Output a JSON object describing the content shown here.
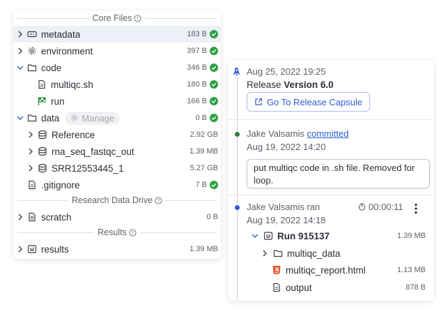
{
  "files_panel": {
    "sections": {
      "core_files": "Core Files",
      "research_data_drive": "Research Data Drive",
      "results": "Results"
    },
    "items": {
      "metadata": {
        "name": "metadata",
        "size": "183 B"
      },
      "environment": {
        "name": "environment",
        "size": "397 B"
      },
      "code": {
        "name": "code",
        "size": "346 B"
      },
      "multiqc_sh": {
        "name": "multiqc.sh",
        "size": "180 B"
      },
      "run": {
        "name": "run",
        "size": "166 B"
      },
      "data": {
        "name": "data",
        "size": "0 B",
        "manage_label": "Manage"
      },
      "reference": {
        "name": "Reference",
        "size": "2.92 GB"
      },
      "rna_seq": {
        "name": "rna_seq_fastqc_out",
        "size": "1.39 MB"
      },
      "srr": {
        "name": "SRR12553445_1",
        "size": "5.27 GB"
      },
      "gitignore": {
        "name": ".gitignore",
        "size": "7 B"
      },
      "scratch": {
        "name": "scratch",
        "size": "0 B"
      },
      "results": {
        "name": "results",
        "size": "1.39 MB"
      }
    }
  },
  "timeline": {
    "release": {
      "date": "Aug 25, 2022 19:25",
      "label_prefix": "Release",
      "version": "Version 6.0",
      "button_label": "Go To Release Capsule"
    },
    "commit": {
      "author": "Jake Valsamis",
      "action": "committed",
      "date": "Aug 19, 2022 14:20",
      "message": "put multiqc code in .sh file. Removed for loop."
    },
    "run": {
      "author_action": "Jake Valsamis ran",
      "duration": "00:00:11",
      "date": "Aug 19, 2022 14:18",
      "name": "Run 915137",
      "size": "1.39 MB",
      "files": {
        "multiqc_data": {
          "name": "multiqc_data"
        },
        "report": {
          "name": "multiqc_report.html",
          "size": "1.13 MB"
        },
        "output": {
          "name": "output",
          "size": "878 B"
        }
      }
    }
  },
  "colors": {
    "accent_blue": "#2f5bd6",
    "success_green": "#2ea043",
    "commit_dot": "#2e7d32",
    "html_orange": "#e4572e"
  }
}
